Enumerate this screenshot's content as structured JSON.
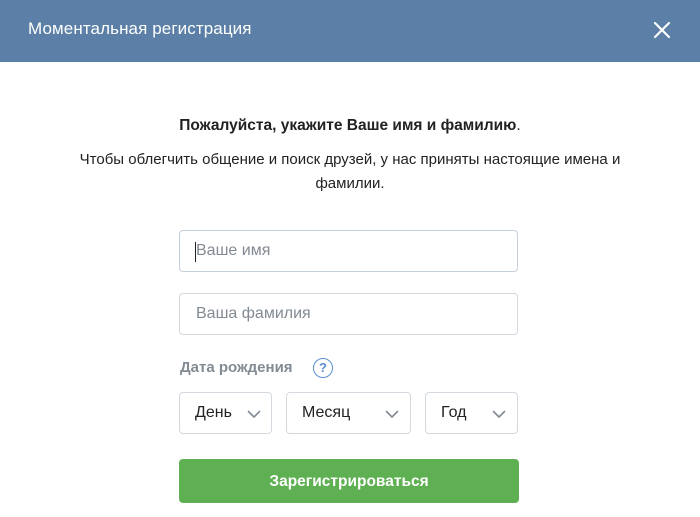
{
  "dialog": {
    "title": "Моментальная регистрация",
    "close_icon": "close-icon"
  },
  "intro": {
    "headline": "Пожалуйста, укажите Ваше имя и фамилию",
    "headline_end": ".",
    "subtext": "Чтобы облегчить общение и поиск друзей, у нас приняты настоящие имена и фамилии."
  },
  "form": {
    "first_name": {
      "placeholder": "Ваше имя",
      "value": ""
    },
    "last_name": {
      "placeholder": "Ваша фамилия",
      "value": ""
    },
    "birth_date": {
      "label": "Дата рождения",
      "help_icon": "question-circle-icon",
      "help_glyph": "?",
      "day": "День",
      "month": "Месяц",
      "year": "Год"
    },
    "submit_label": "Зарегистрироваться"
  },
  "colors": {
    "header": "#5b7fa6",
    "submit": "#5fb053",
    "help": "#5b8fd2",
    "muted_text": "#828a93",
    "border": "#d3d9de"
  }
}
